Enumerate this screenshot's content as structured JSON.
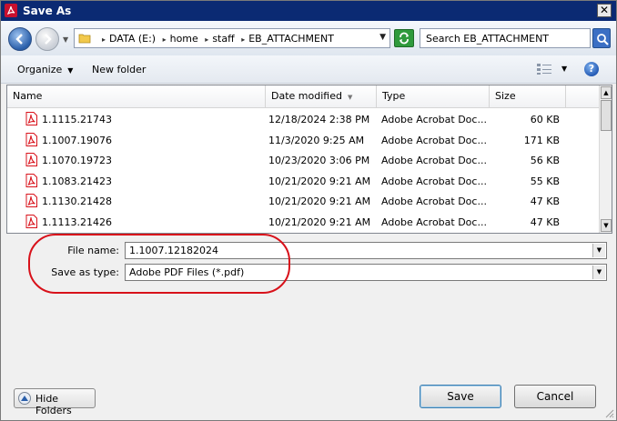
{
  "window": {
    "title": "Save As",
    "close_glyph": "✕"
  },
  "address": {
    "crumbs": [
      "DATA (E:)",
      "home",
      "staff",
      "EB_ATTACHMENT"
    ],
    "separator": "▸"
  },
  "search": {
    "text": "Search EB_ATTACHMENT"
  },
  "toolbar": {
    "organize_label": "Organize",
    "new_folder_label": "New folder",
    "help_glyph": "?"
  },
  "columns": {
    "name": "Name",
    "date_modified": "Date modified",
    "type": "Type",
    "size": "Size"
  },
  "files": [
    {
      "name": "1.1115.21743",
      "date": "12/18/2024 2:38 PM",
      "type": "Adobe Acrobat Doc...",
      "size": "60 KB"
    },
    {
      "name": "1.1007.19076",
      "date": "11/3/2020 9:25 AM",
      "type": "Adobe Acrobat Doc...",
      "size": "171 KB"
    },
    {
      "name": "1.1070.19723",
      "date": "10/23/2020 3:06 PM",
      "type": "Adobe Acrobat Doc...",
      "size": "56 KB"
    },
    {
      "name": "1.1083.21423",
      "date": "10/21/2020 9:21 AM",
      "type": "Adobe Acrobat Doc...",
      "size": "55 KB"
    },
    {
      "name": "1.1130.21428",
      "date": "10/21/2020 9:21 AM",
      "type": "Adobe Acrobat Doc...",
      "size": "47 KB"
    },
    {
      "name": "1.1113.21426",
      "date": "10/21/2020 9:21 AM",
      "type": "Adobe Acrobat Doc...",
      "size": "47 KB"
    }
  ],
  "form": {
    "file_name_label": "File name:",
    "file_name_value": "1.1007.12182024",
    "save_type_label": "Save as type:",
    "save_type_value": "Adobe PDF Files (*.pdf)"
  },
  "footer": {
    "hide_folders_label": "Hide Folders",
    "save_label": "Save",
    "cancel_label": "Cancel"
  },
  "colors": {
    "titlebar": "#0b2a73",
    "pdf_red": "#d8111a",
    "highlight": "#d8111a"
  }
}
